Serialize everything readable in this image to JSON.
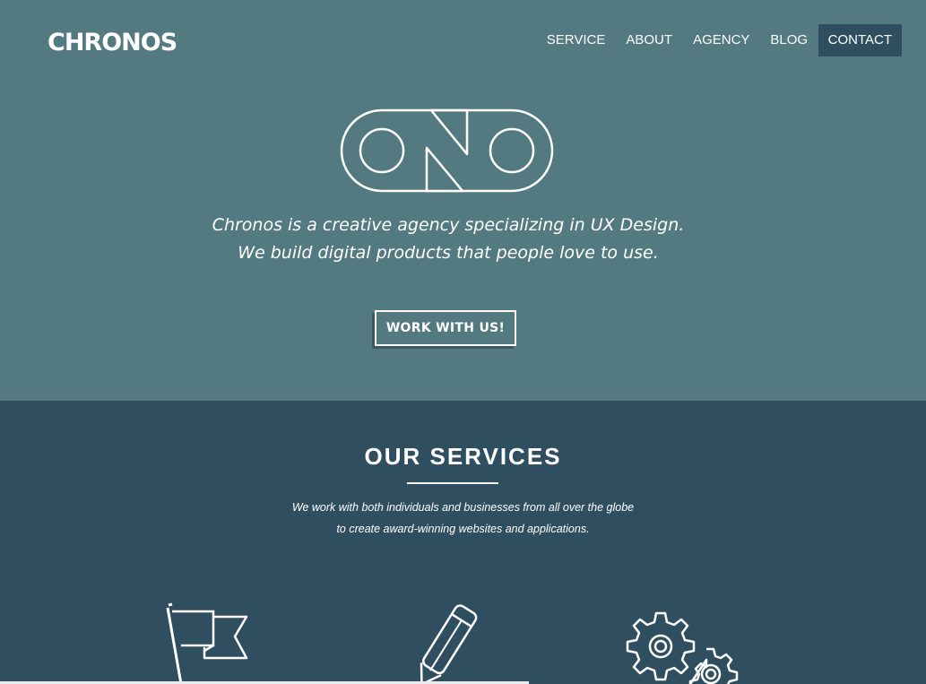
{
  "header": {
    "logo_text": "CHRONOS",
    "nav": [
      {
        "label": "SERVICE"
      },
      {
        "label": "ABOUT"
      },
      {
        "label": "AGENCY"
      },
      {
        "label": "BLOG"
      },
      {
        "label": "CONTACT",
        "active": true
      }
    ]
  },
  "hero": {
    "emblem": "chrono-emblem-icon",
    "tagline_line1": "Chronos is a creative agency specializing in UX Design.",
    "tagline_line2": "We build digital products that people love to use.",
    "cta_label": "WORK WITH US!"
  },
  "services": {
    "title": "OUR SERVICES",
    "desc_line1": "We work with both individuals and businesses from all over the globe",
    "desc_line2": "to create award-winning websites and applications.",
    "icons": [
      "flag-icon",
      "pencil-icon",
      "gears-icon"
    ]
  },
  "colors": {
    "hero_bg": "#537a80",
    "section_bg": "#2f4f61",
    "active_nav_bg": "#2f4f61",
    "text": "#ffffff"
  }
}
